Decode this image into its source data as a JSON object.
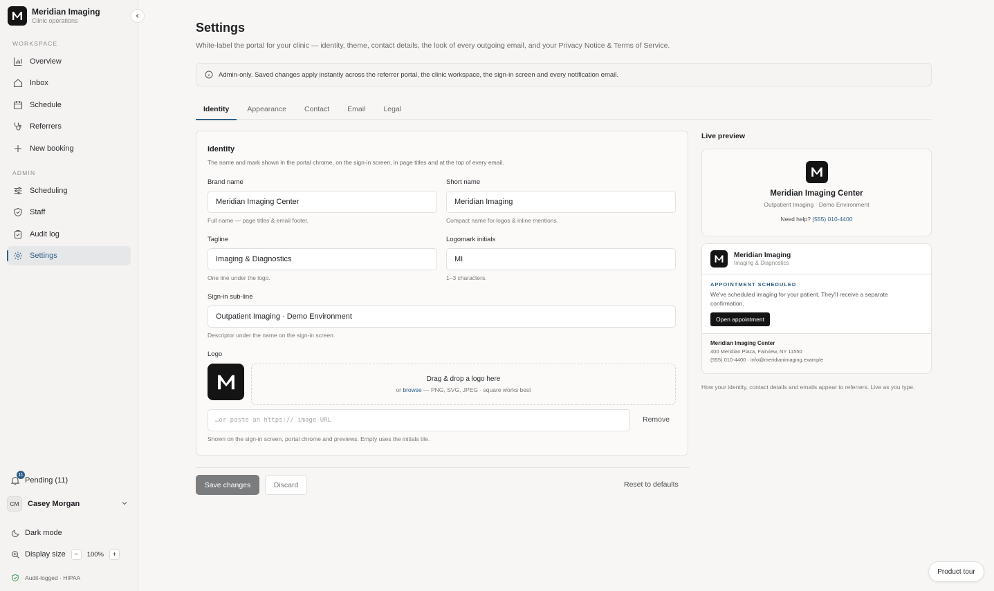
{
  "brand": {
    "title": "Meridian Imaging",
    "subtitle": "Clinic operations",
    "logo_letter": "M"
  },
  "sidebar": {
    "workspace_label": "WORKSPACE",
    "workspace_items": [
      {
        "label": "Overview",
        "icon": "bar-chart-icon"
      },
      {
        "label": "Inbox",
        "icon": "home-icon"
      },
      {
        "label": "Schedule",
        "icon": "calendar-icon"
      },
      {
        "label": "Referrers",
        "icon": "stethoscope-icon"
      },
      {
        "label": "New booking",
        "icon": "plus-icon"
      }
    ],
    "admin_label": "ADMIN",
    "admin_items": [
      {
        "label": "Scheduling",
        "icon": "sliders-icon"
      },
      {
        "label": "Staff",
        "icon": "shield-icon"
      },
      {
        "label": "Audit log",
        "icon": "clipboard-icon"
      },
      {
        "label": "Settings",
        "icon": "gear-icon",
        "active": true
      }
    ],
    "pending_label": "Pending (11)",
    "pending_count": "11",
    "user": {
      "initials": "CM",
      "name": "Casey Morgan"
    },
    "dark_mode_label": "Dark mode",
    "display_size_label": "Display size",
    "zoom_value": "100%",
    "compliance_label": "Audit-logged · HIPAA"
  },
  "page": {
    "title": "Settings",
    "description": "White-label the portal for your clinic — identity, theme, contact details, the look of every outgoing email, and your Privacy Notice & Terms of Service.",
    "notice": "Admin-only. Saved changes apply instantly across the referrer portal, the clinic workspace, the sign-in screen and every notification email."
  },
  "tabs": [
    "Identity",
    "Appearance",
    "Contact",
    "Email",
    "Legal"
  ],
  "identity": {
    "title": "Identity",
    "description": "The name and mark shown in the portal chrome, on the sign-in screen, in page titles and at the top of every email.",
    "brand_name": {
      "label": "Brand name",
      "value": "Meridian Imaging Center",
      "help": "Full name — page titles & email footer."
    },
    "short_name": {
      "label": "Short name",
      "value": "Meridian Imaging",
      "help": "Compact name for logos & inline mentions."
    },
    "tagline": {
      "label": "Tagline",
      "value": "Imaging & Diagnostics",
      "help": "One line under the logo."
    },
    "initials": {
      "label": "Logomark initials",
      "value": "MI",
      "help": "1–3 characters."
    },
    "signin_subline": {
      "label": "Sign-in sub-line",
      "value": "Outpatient Imaging · Demo Environment",
      "help": "Descriptor under the name on the sign-in screen."
    },
    "logo": {
      "label": "Logo",
      "drop_main": "Drag & drop a logo here",
      "drop_prefix": "or ",
      "drop_link": "browse",
      "drop_suffix": " — PNG, SVG, JPEG · square works best",
      "url_placeholder": "…or paste an https:// image URL",
      "remove_label": "Remove",
      "help": "Shown on the sign-in screen, portal chrome and previews. Empty uses the initials tile."
    }
  },
  "actions": {
    "save": "Save changes",
    "discard": "Discard",
    "reset": "Reset to defaults"
  },
  "preview": {
    "title": "Live preview",
    "signin": {
      "name": "Meridian Imaging Center",
      "subline": "Outpatient Imaging · Demo Environment",
      "help_prefix": "Need help? ",
      "help_phone": "(555) 010-4400"
    },
    "email": {
      "header_name": "Meridian Imaging",
      "header_tagline": "Imaging & Diagnostics",
      "kicker": "APPOINTMENT SCHEDULED",
      "body": "We've scheduled imaging for your patient. They'll receive a separate confirmation.",
      "button": "Open appointment",
      "footer_name": "Meridian Imaging Center",
      "footer_address": "400 Meridian Plaza, Fairview, NY 11550",
      "footer_contact": "(555) 010-4400 · info@meridianimaging.example"
    },
    "caption": "How your identity, contact details and emails appear to referrers. Live as you type."
  },
  "product_tour": "Product tour",
  "colors": {
    "accent": "#2f5f86",
    "logo_bg": "#141414"
  }
}
